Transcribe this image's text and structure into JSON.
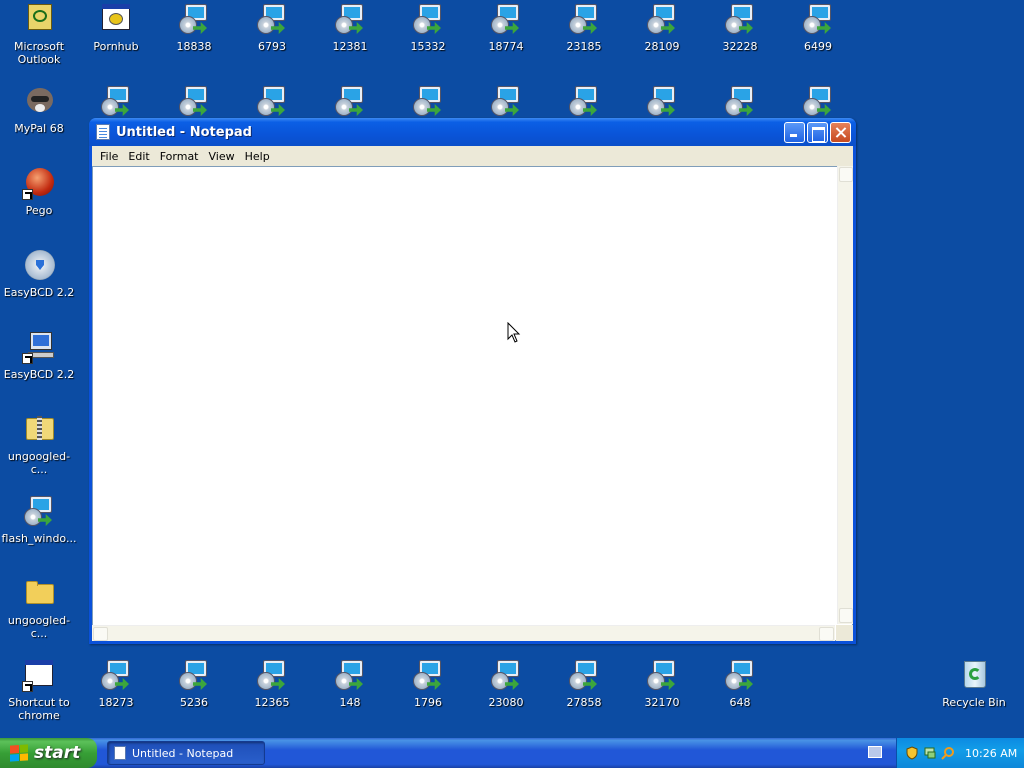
{
  "desktop": {
    "icons_row1": [
      "Microsoft Outlook",
      "Pornhub",
      "18838",
      "6793",
      "12381",
      "15332",
      "18774",
      "23185",
      "28109",
      "32228",
      "6499"
    ],
    "icons_left": [
      "MyPal 68",
      "Pego",
      "EasyBCD 2.2",
      "EasyBCD 2.2",
      "ungoogled-c...",
      "flash_windo...",
      "ungoogled-c...",
      "Shortcut to chrome"
    ],
    "icons_bottom": [
      "18273",
      "5236",
      "12365",
      "148",
      "1796",
      "23080",
      "27858",
      "32170",
      "648"
    ],
    "recycle_bin": "Recycle Bin"
  },
  "window": {
    "title": "Untitled - Notepad",
    "menu": [
      "File",
      "Edit",
      "Format",
      "View",
      "Help"
    ],
    "content": ""
  },
  "taskbar": {
    "start_label": "start",
    "task_label": "Untitled - Notepad",
    "clock": "10:26 AM"
  }
}
